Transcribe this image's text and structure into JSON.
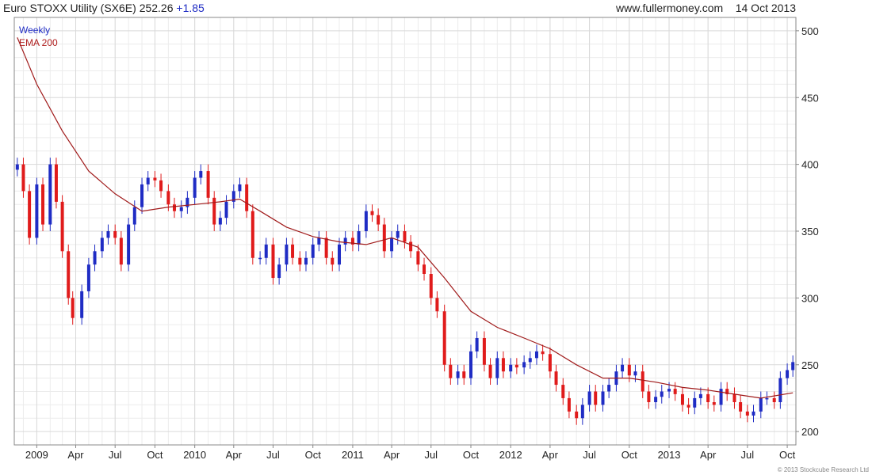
{
  "header": {
    "instrument": "Euro STOXX Utility (SX6E)",
    "price": "252.26",
    "change": "+1.85",
    "site": "www.fullermoney.com",
    "date": "14 Oct 2013"
  },
  "copyright": "© 2013 Stockcube Research Ltd",
  "colors": {
    "up": "#1f2cc4",
    "down": "#e01b1b",
    "ema": "#a01a1a",
    "grid": "#d9d9d9",
    "frame": "#888888"
  },
  "chart_data": {
    "type": "line",
    "title": "Euro STOXX Utility (SX6E) 252.26 +1.85",
    "legend": [
      "Weekly",
      "EMA 200"
    ],
    "legend_position": "top-left",
    "y_axis_side": "right",
    "ylim": [
      190,
      510
    ],
    "yticks": [
      200,
      250,
      300,
      350,
      400,
      450,
      500
    ],
    "xlim": [
      "2008-11-10",
      "2013-10-21"
    ],
    "xticks": [
      {
        "label": "2009",
        "date": "2009-01-01"
      },
      {
        "label": "Apr",
        "date": "2009-04-01"
      },
      {
        "label": "Jul",
        "date": "2009-07-01"
      },
      {
        "label": "Oct",
        "date": "2009-10-01"
      },
      {
        "label": "2010",
        "date": "2010-01-01"
      },
      {
        "label": "Apr",
        "date": "2010-04-01"
      },
      {
        "label": "Jul",
        "date": "2010-07-01"
      },
      {
        "label": "Oct",
        "date": "2010-10-01"
      },
      {
        "label": "2011",
        "date": "2011-01-01"
      },
      {
        "label": "Apr",
        "date": "2011-04-01"
      },
      {
        "label": "Jul",
        "date": "2011-07-01"
      },
      {
        "label": "Oct",
        "date": "2011-10-01"
      },
      {
        "label": "2012",
        "date": "2012-01-01"
      },
      {
        "label": "Apr",
        "date": "2012-04-01"
      },
      {
        "label": "Jul",
        "date": "2012-07-01"
      },
      {
        "label": "Oct",
        "date": "2012-10-01"
      },
      {
        "label": "2013",
        "date": "2013-01-01"
      },
      {
        "label": "Apr",
        "date": "2013-04-01"
      },
      {
        "label": "Jul",
        "date": "2013-07-01"
      },
      {
        "label": "Oct",
        "date": "2013-10-01"
      }
    ],
    "grid": true,
    "series": [
      {
        "name": "Weekly",
        "style": "candlestick",
        "points": [
          [
            "2008-11-17",
            400
          ],
          [
            "2008-12-01",
            380
          ],
          [
            "2008-12-15",
            345
          ],
          [
            "2009-01-01",
            385
          ],
          [
            "2009-01-15",
            355
          ],
          [
            "2009-02-01",
            400
          ],
          [
            "2009-02-15",
            372
          ],
          [
            "2009-03-01",
            335
          ],
          [
            "2009-03-15",
            300
          ],
          [
            "2009-03-25",
            285
          ],
          [
            "2009-04-15",
            305
          ],
          [
            "2009-05-01",
            325
          ],
          [
            "2009-05-15",
            335
          ],
          [
            "2009-06-01",
            345
          ],
          [
            "2009-06-15",
            350
          ],
          [
            "2009-07-01",
            345
          ],
          [
            "2009-07-15",
            325
          ],
          [
            "2009-08-01",
            355
          ],
          [
            "2009-08-15",
            368
          ],
          [
            "2009-09-01",
            385
          ],
          [
            "2009-09-15",
            390
          ],
          [
            "2009-10-01",
            388
          ],
          [
            "2009-10-15",
            380
          ],
          [
            "2009-11-01",
            370
          ],
          [
            "2009-11-15",
            365
          ],
          [
            "2009-12-01",
            368
          ],
          [
            "2009-12-15",
            375
          ],
          [
            "2010-01-01",
            390
          ],
          [
            "2010-01-15",
            395
          ],
          [
            "2010-02-01",
            375
          ],
          [
            "2010-02-15",
            355
          ],
          [
            "2010-03-01",
            360
          ],
          [
            "2010-03-15",
            372
          ],
          [
            "2010-04-01",
            380
          ],
          [
            "2010-04-15",
            385
          ],
          [
            "2010-05-01",
            365
          ],
          [
            "2010-05-15",
            330
          ],
          [
            "2010-06-01",
            330
          ],
          [
            "2010-06-15",
            340
          ],
          [
            "2010-07-01",
            315
          ],
          [
            "2010-07-15",
            325
          ],
          [
            "2010-08-01",
            340
          ],
          [
            "2010-08-15",
            330
          ],
          [
            "2010-09-01",
            325
          ],
          [
            "2010-09-15",
            330
          ],
          [
            "2010-10-01",
            340
          ],
          [
            "2010-10-15",
            345
          ],
          [
            "2010-11-01",
            330
          ],
          [
            "2010-11-15",
            325
          ],
          [
            "2010-12-01",
            340
          ],
          [
            "2010-12-15",
            345
          ],
          [
            "2011-01-01",
            340
          ],
          [
            "2011-01-15",
            350
          ],
          [
            "2011-02-01",
            365
          ],
          [
            "2011-02-15",
            362
          ],
          [
            "2011-03-01",
            355
          ],
          [
            "2011-03-15",
            335
          ],
          [
            "2011-04-01",
            345
          ],
          [
            "2011-04-15",
            350
          ],
          [
            "2011-05-01",
            342
          ],
          [
            "2011-05-15",
            335
          ],
          [
            "2011-06-01",
            325
          ],
          [
            "2011-06-15",
            318
          ],
          [
            "2011-07-01",
            300
          ],
          [
            "2011-07-15",
            290
          ],
          [
            "2011-08-01",
            250
          ],
          [
            "2011-08-15",
            240
          ],
          [
            "2011-09-01",
            245
          ],
          [
            "2011-09-15",
            240
          ],
          [
            "2011-10-01",
            260
          ],
          [
            "2011-10-15",
            270
          ],
          [
            "2011-11-01",
            250
          ],
          [
            "2011-11-15",
            240
          ],
          [
            "2011-12-01",
            255
          ],
          [
            "2011-12-15",
            245
          ],
          [
            "2012-01-01",
            250
          ],
          [
            "2012-01-15",
            248
          ],
          [
            "2012-02-01",
            252
          ],
          [
            "2012-02-15",
            255
          ],
          [
            "2012-03-01",
            260
          ],
          [
            "2012-03-15",
            258
          ],
          [
            "2012-04-01",
            245
          ],
          [
            "2012-04-15",
            235
          ],
          [
            "2012-05-01",
            225
          ],
          [
            "2012-05-15",
            215
          ],
          [
            "2012-06-01",
            210
          ],
          [
            "2012-06-15",
            220
          ],
          [
            "2012-07-01",
            230
          ],
          [
            "2012-07-15",
            220
          ],
          [
            "2012-08-01",
            230
          ],
          [
            "2012-08-15",
            235
          ],
          [
            "2012-09-01",
            245
          ],
          [
            "2012-09-15",
            250
          ],
          [
            "2012-10-01",
            242
          ],
          [
            "2012-10-15",
            245
          ],
          [
            "2012-11-01",
            230
          ],
          [
            "2012-11-15",
            222
          ],
          [
            "2012-12-01",
            226
          ],
          [
            "2012-12-15",
            230
          ],
          [
            "2013-01-01",
            232
          ],
          [
            "2013-01-15",
            228
          ],
          [
            "2013-02-01",
            220
          ],
          [
            "2013-02-15",
            218
          ],
          [
            "2013-03-01",
            225
          ],
          [
            "2013-03-15",
            228
          ],
          [
            "2013-04-01",
            222
          ],
          [
            "2013-04-15",
            220
          ],
          [
            "2013-05-01",
            232
          ],
          [
            "2013-05-15",
            228
          ],
          [
            "2013-06-01",
            222
          ],
          [
            "2013-06-15",
            215
          ],
          [
            "2013-07-01",
            212
          ],
          [
            "2013-07-15",
            215
          ],
          [
            "2013-08-01",
            225
          ],
          [
            "2013-08-15",
            225
          ],
          [
            "2013-09-01",
            222
          ],
          [
            "2013-09-15",
            240
          ],
          [
            "2013-10-01",
            246
          ],
          [
            "2013-10-14",
            252
          ]
        ]
      },
      {
        "name": "EMA 200",
        "style": "line",
        "points": [
          [
            "2008-11-17",
            495
          ],
          [
            "2009-01-01",
            460
          ],
          [
            "2009-03-01",
            425
          ],
          [
            "2009-05-01",
            395
          ],
          [
            "2009-07-01",
            378
          ],
          [
            "2009-09-01",
            365
          ],
          [
            "2009-11-01",
            368
          ],
          [
            "2010-01-01",
            370
          ],
          [
            "2010-03-01",
            372
          ],
          [
            "2010-04-15",
            374
          ],
          [
            "2010-06-01",
            365
          ],
          [
            "2010-08-01",
            353
          ],
          [
            "2010-10-01",
            346
          ],
          [
            "2010-12-01",
            342
          ],
          [
            "2011-02-01",
            340
          ],
          [
            "2011-04-01",
            345
          ],
          [
            "2011-06-01",
            338
          ],
          [
            "2011-08-01",
            315
          ],
          [
            "2011-10-01",
            290
          ],
          [
            "2011-12-01",
            278
          ],
          [
            "2012-02-01",
            270
          ],
          [
            "2012-04-01",
            262
          ],
          [
            "2012-06-01",
            250
          ],
          [
            "2012-08-01",
            240
          ],
          [
            "2012-10-01",
            240
          ],
          [
            "2012-12-01",
            237
          ],
          [
            "2013-02-01",
            233
          ],
          [
            "2013-04-01",
            231
          ],
          [
            "2013-06-01",
            228
          ],
          [
            "2013-08-01",
            225
          ],
          [
            "2013-10-14",
            229
          ]
        ]
      }
    ]
  }
}
